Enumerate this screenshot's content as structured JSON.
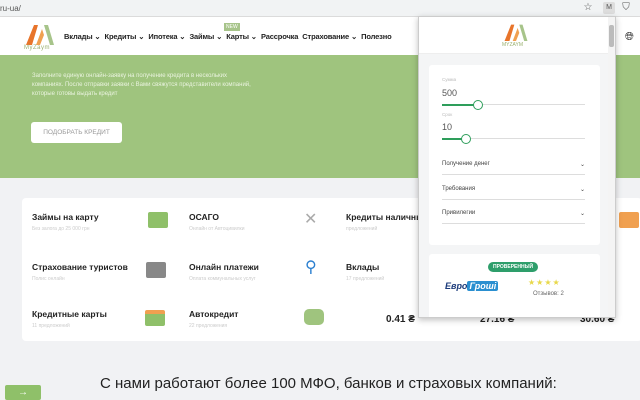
{
  "browser": {
    "url": "ru-ua/"
  },
  "header": {
    "logo_text": "MyZaym",
    "nav": [
      "Вклады ⌄",
      "Кредиты ⌄",
      "Ипотека ⌄",
      "Займы ⌄",
      "Карты ⌄",
      "Рассрочка",
      "Страхование ⌄",
      "Полезно"
    ],
    "new_badge": "NEW"
  },
  "hero": {
    "text": "Заполните единую онлайн-заявку на получение кредита в нескольких компаниях. После отправки заявки с Вами свяжутся представители компаний, которые готовы выдать кредит",
    "button": "ПОДОБРАТЬ КРЕДИТ"
  },
  "items": [
    {
      "title": "Займы на карту",
      "sub": "Без залога до 25 000 грн"
    },
    {
      "title": "ОСАГО",
      "sub": "Онлайн от Автоцивилки"
    },
    {
      "title": "Кредиты наличными",
      "sub": "предложений"
    },
    {
      "title": "Страхование туристов",
      "sub": "Полис онлайн"
    },
    {
      "title": "Онлайн платежи",
      "sub": "Оплата коммунальных услуг"
    },
    {
      "title": "Вклады",
      "sub": "17 предложений"
    },
    {
      "title": "Кредитные карты",
      "sub": "11 предложений"
    },
    {
      "title": "Автокредит",
      "sub": "22 предложения"
    }
  ],
  "prices": [
    "0.41 ₴",
    "27.16 ₴",
    "30.60 ₴"
  ],
  "bottom_title": "С нами работают более 100 МФО, банков и страховых компаний:",
  "popup": {
    "logo_text": "MYZAYM",
    "amount_label": "Сумма",
    "amount": "500",
    "amount_fraction": 0.25,
    "term_label": "Срок",
    "term": "10",
    "term_fraction": 0.17,
    "selects": [
      "Получение денег",
      "Требования",
      "Привилегии"
    ],
    "badge": "ПРОВЕРЕННЫЙ",
    "lender_a": "Евро",
    "lender_b": "Гроші",
    "stars": "★★★★",
    "reviews": "Отзывов: 2"
  },
  "colors": {
    "green": "#9fc47e",
    "accent": "#2e9e5b"
  }
}
